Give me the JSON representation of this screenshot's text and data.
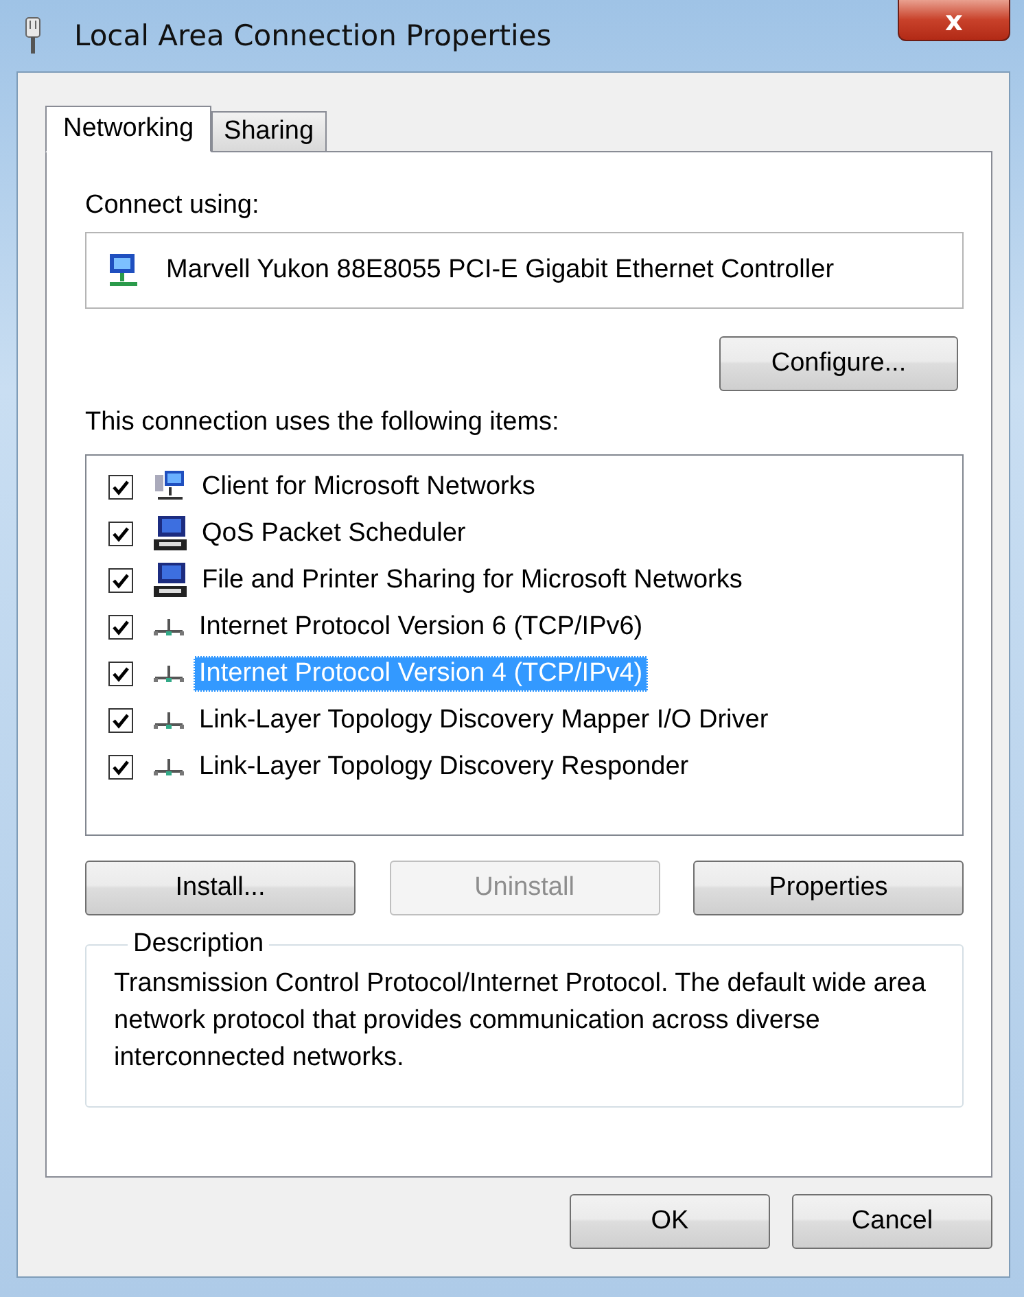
{
  "window": {
    "title": "Local Area Connection Properties",
    "close": "x"
  },
  "tabs": [
    {
      "label": "Networking",
      "selected": true
    },
    {
      "label": "Sharing",
      "selected": false
    }
  ],
  "connect_using": {
    "label": "Connect using:",
    "adapter": "Marvell Yukon 88E8055 PCI-E Gigabit Ethernet Controller",
    "configure_button": "Configure..."
  },
  "items_label": "This connection uses the following items:",
  "items": [
    {
      "kind": "client",
      "label": "Client for Microsoft Networks",
      "checked": true,
      "selected": false
    },
    {
      "kind": "service",
      "label": "QoS Packet Scheduler",
      "checked": true,
      "selected": false
    },
    {
      "kind": "service",
      "label": "File and Printer Sharing for Microsoft Networks",
      "checked": true,
      "selected": false
    },
    {
      "kind": "protocol",
      "label": "Internet Protocol Version 6 (TCP/IPv6)",
      "checked": true,
      "selected": false
    },
    {
      "kind": "protocol",
      "label": "Internet Protocol Version 4 (TCP/IPv4)",
      "checked": true,
      "selected": true
    },
    {
      "kind": "protocol",
      "label": "Link-Layer Topology Discovery Mapper I/O Driver",
      "checked": true,
      "selected": false
    },
    {
      "kind": "protocol",
      "label": "Link-Layer Topology Discovery Responder",
      "checked": true,
      "selected": false
    }
  ],
  "item_buttons": [
    {
      "label": "Install...",
      "disabled": false
    },
    {
      "label": "Uninstall",
      "disabled": true
    },
    {
      "label": "Properties",
      "disabled": false
    }
  ],
  "description": {
    "title": "Description",
    "text": "Transmission Control Protocol/Internet Protocol. The default wide area network protocol that provides communication across diverse interconnected networks."
  },
  "dialog_buttons": [
    {
      "label": "OK",
      "disabled": false
    },
    {
      "label": "Cancel",
      "disabled": false
    }
  ]
}
